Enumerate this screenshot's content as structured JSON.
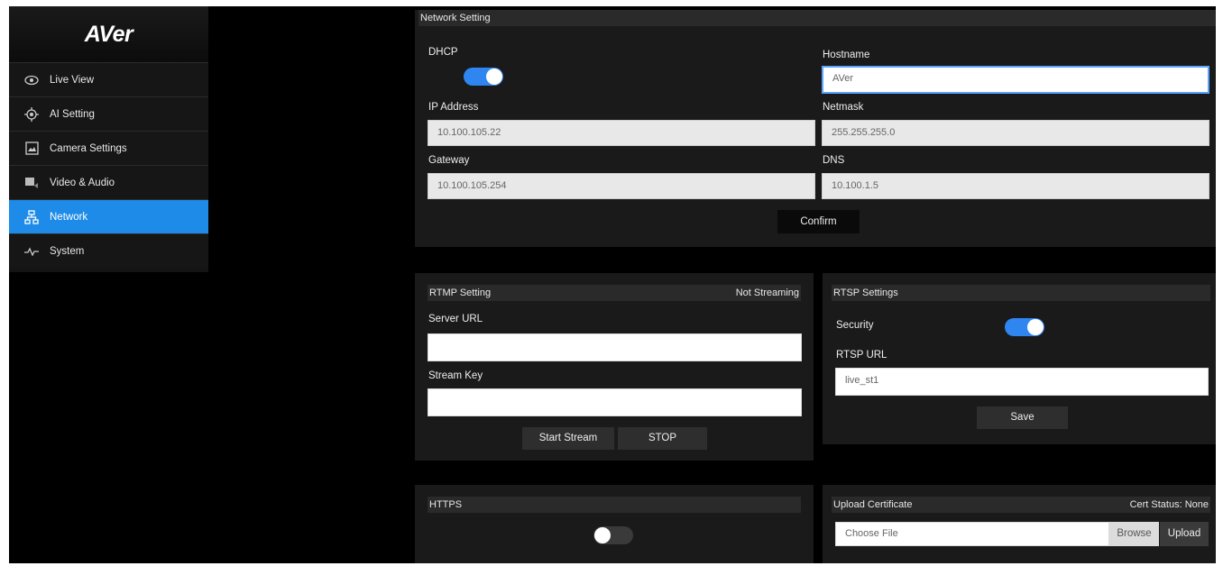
{
  "sidebar": {
    "logo": "AVer",
    "items": [
      {
        "label": "Live View",
        "icon": "eye-icon"
      },
      {
        "label": "AI Setting",
        "icon": "target-icon"
      },
      {
        "label": "Camera Settings",
        "icon": "image-icon"
      },
      {
        "label": "Video & Audio",
        "icon": "video-audio-icon"
      },
      {
        "label": "Network",
        "icon": "network-icon",
        "active": true
      },
      {
        "label": "System",
        "icon": "pulse-icon"
      }
    ]
  },
  "network_setting": {
    "title": "Network Setting",
    "dhcp_label": "DHCP",
    "dhcp_on": true,
    "hostname_label": "Hostname",
    "hostname_value": "AVer",
    "ip_label": "IP Address",
    "ip_value": "10.100.105.22",
    "netmask_label": "Netmask",
    "netmask_value": "255.255.255.0",
    "gateway_label": "Gateway",
    "gateway_value": "10.100.105.254",
    "dns_label": "DNS",
    "dns_value": "10.100.1.5",
    "confirm_label": "Confirm"
  },
  "rtmp": {
    "title": "RTMP Setting",
    "status": "Not Streaming",
    "server_url_label": "Server URL",
    "server_url_value": "",
    "stream_key_label": "Stream Key",
    "stream_key_value": "",
    "start_label": "Start Stream",
    "stop_label": "STOP"
  },
  "rtsp": {
    "title": "RTSP Settings",
    "security_label": "Security",
    "security_on": true,
    "url_label": "RTSP URL",
    "url_value": "live_st1",
    "save_label": "Save"
  },
  "https": {
    "title": "HTTPS",
    "enabled": false
  },
  "certificate": {
    "title": "Upload Certificate",
    "status": "Cert Status: None",
    "file_placeholder": "Choose File",
    "browse_label": "Browse",
    "upload_label": "Upload"
  },
  "colors": {
    "accent": "#1e8be8",
    "toggle_on": "#2f86f0",
    "panel_bg": "#1a1a1a"
  }
}
